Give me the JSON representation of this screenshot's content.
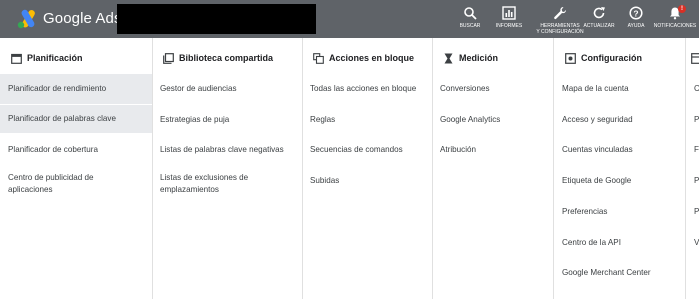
{
  "header": {
    "brand": "Google Ads",
    "colors": {
      "bar": "#5f6368",
      "badge": "#d93025"
    },
    "buttons": [
      {
        "icon": "search-icon",
        "label": "BUSCAR"
      },
      {
        "icon": "reports-icon",
        "label": "INFORMES"
      },
      {
        "icon": "wrench-icon",
        "label": "HERRAMIENTAS\nY CONFIGURACIÓN"
      },
      {
        "icon": "refresh-icon",
        "label": "ACTUALIZAR"
      },
      {
        "icon": "help-icon",
        "label": "AYUDA"
      },
      {
        "icon": "bell-icon",
        "label": "NOTIFICACIONES",
        "badge": "!"
      }
    ]
  },
  "columns": [
    {
      "id": "planificacion",
      "icon": "calendar-icon",
      "title": "Planificación",
      "items": [
        "Planificador de rendimiento",
        "Planificador de palabras clave",
        "Planificador de cobertura",
        "Centro de publicidad de aplicaciones"
      ]
    },
    {
      "id": "biblioteca",
      "icon": "library-icon",
      "title": "Biblioteca compartida",
      "items": [
        "Gestor de audiencias",
        "Estrategias de puja",
        "Listas de palabras clave negativas",
        "Listas de exclusiones de emplazamientos"
      ]
    },
    {
      "id": "acciones",
      "icon": "bulk-actions-icon",
      "title": "Acciones en bloque",
      "items": [
        "Todas las acciones en bloque",
        "Reglas",
        "Secuencias de comandos",
        "Subidas"
      ]
    },
    {
      "id": "medicion",
      "icon": "hourglass-icon",
      "title": "Medición",
      "items": [
        "Conversiones",
        "Google Analytics",
        "Atribución"
      ]
    },
    {
      "id": "configuracion",
      "icon": "settings-icon",
      "title": "Configuración",
      "items": [
        "Mapa de la cuenta",
        "Acceso y seguridad",
        "Cuentas vinculadas",
        "Etiqueta de Google",
        "Preferencias",
        "Centro de la API",
        "Google Merchant Center"
      ]
    },
    {
      "id": "facturacion",
      "icon": "billing-icon",
      "title": "",
      "items": [
        "C",
        "P",
        "F",
        "P",
        "P",
        "V"
      ]
    }
  ]
}
